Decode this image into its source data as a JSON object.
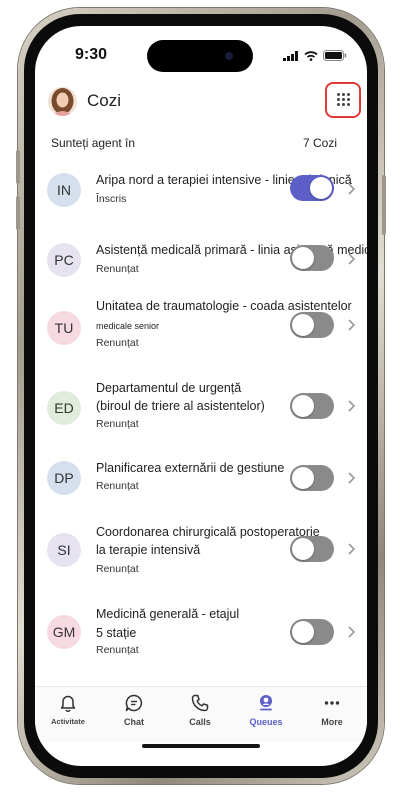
{
  "status_bar": {
    "time": "9:30"
  },
  "header": {
    "title": "Cozi"
  },
  "subheader": {
    "left": "Sunteți agent în",
    "right": "7 Cozi"
  },
  "queues": [
    {
      "initials": "IN",
      "badge_color": "#d5dfee",
      "title_line1": "Aripa nord a terapiei intensive - linie telefonică",
      "title_line2": "",
      "small_line": "",
      "status": "Înscris",
      "enabled": true
    },
    {
      "initials": "PC",
      "badge_color": "#e6e2f0",
      "title_line1": "Asistență medicală primară - linia asistentă medicală",
      "title_line2": "",
      "small_line": "",
      "status": "Renunțat",
      "enabled": false
    },
    {
      "initials": "TU",
      "badge_color": "#f6d9e1",
      "title_line1": "Unitatea de traumatologie - coada asistentelor",
      "title_line2": "",
      "small_line": "medicale senior",
      "status": "Renunțat",
      "enabled": false
    },
    {
      "initials": "ED",
      "badge_color": "#e2ecdc",
      "title_line1": "Departamentul de urgență",
      "title_line2": "(biroul de triere al asistentelor)",
      "small_line": "",
      "status": "Renunțat",
      "enabled": false
    },
    {
      "initials": "DP",
      "badge_color": "#d5dfee",
      "title_line1": "Planificarea externării de gestiune",
      "title_line2": "",
      "small_line": "",
      "status": "Renunțat",
      "enabled": false
    },
    {
      "initials": "SI",
      "badge_color": "#e6e2f0",
      "title_line1": "Coordonarea chirurgicală postoperatorie",
      "title_line2": "la terapie intensivă",
      "small_line": "",
      "status": "Renunțat",
      "enabled": false
    },
    {
      "initials": "GM",
      "badge_color": "#f6d9e1",
      "title_line1": "Medicină generală - etajul",
      "title_line2": "5 stație",
      "small_line": "",
      "status": "Renunțat",
      "enabled": false
    }
  ],
  "tabs": [
    {
      "label": "Activitate",
      "icon": "bell-icon"
    },
    {
      "label": "Chat",
      "icon": "chat-icon"
    },
    {
      "label": "Calls",
      "icon": "phone-icon"
    },
    {
      "label": "Queues",
      "icon": "queues-icon",
      "active": true
    },
    {
      "label": "More",
      "icon": "more-icon"
    }
  ],
  "colors": {
    "accent": "#5b5fc7",
    "highlight_border": "#e03a3a",
    "toggle_off": "#8a8a8a"
  }
}
